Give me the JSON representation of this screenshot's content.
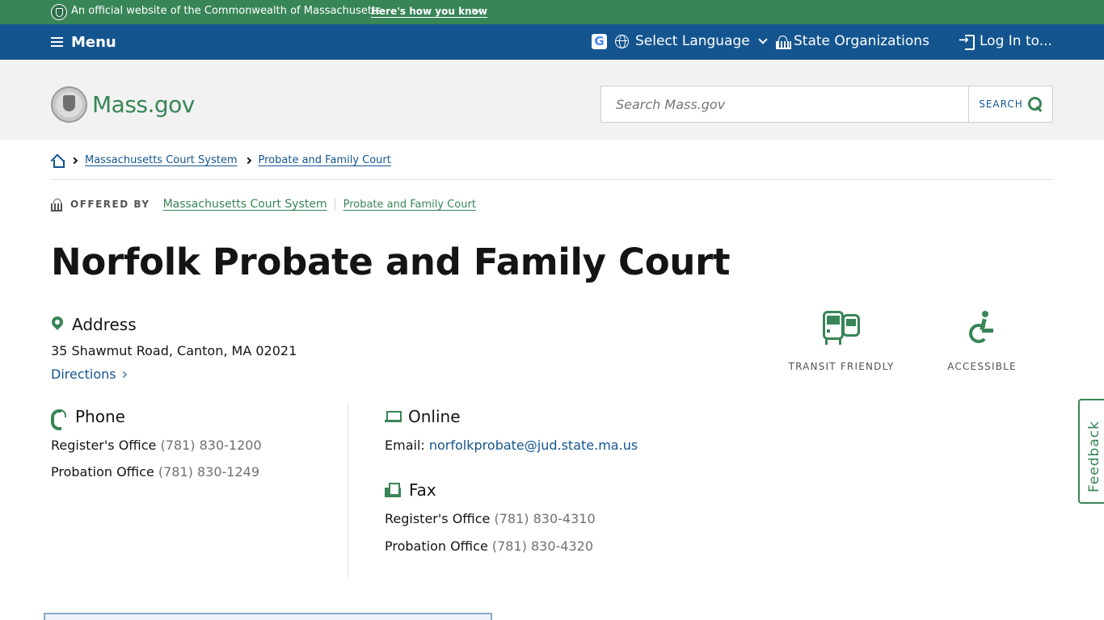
{
  "official_banner": {
    "text": "An official website of the Commonwealth of Massachusetts",
    "link": "Here's how you know"
  },
  "nav": {
    "menu": "Menu",
    "google_translate": "G",
    "language": "Select Language",
    "state_orgs": "State Organizations",
    "login": "Log In to..."
  },
  "header": {
    "logo": "Mass.gov",
    "search_placeholder": "Search Mass.gov",
    "search_button": "SEARCH"
  },
  "breadcrumb": {
    "items": [
      "Massachusetts Court System",
      "Probate and Family Court"
    ]
  },
  "offered_by": {
    "label": "OFFERED BY",
    "orgs": [
      "Massachusetts Court System",
      "Probate and Family Court"
    ]
  },
  "page_title": "Norfolk Probate and Family Court",
  "address": {
    "heading": "Address",
    "line": "35 Shawmut Road, Canton, MA 02021",
    "directions": "Directions"
  },
  "features": {
    "transit": "TRANSIT FRIENDLY",
    "accessible": "ACCESSIBLE"
  },
  "phone": {
    "heading": "Phone",
    "entries": [
      {
        "label": "Register's Office",
        "number": "(781) 830-1200"
      },
      {
        "label": "Probation Office",
        "number": "(781) 830-1249"
      }
    ]
  },
  "online": {
    "heading": "Online",
    "email_label": "Email:",
    "email": "norfolkprobate@jud.state.ma.us"
  },
  "fax": {
    "heading": "Fax",
    "entries": [
      {
        "label": "Register's Office",
        "number": "(781) 830-4310"
      },
      {
        "label": "Probation Office",
        "number": "(781) 830-4320"
      }
    ]
  },
  "feedback": "Feedback"
}
